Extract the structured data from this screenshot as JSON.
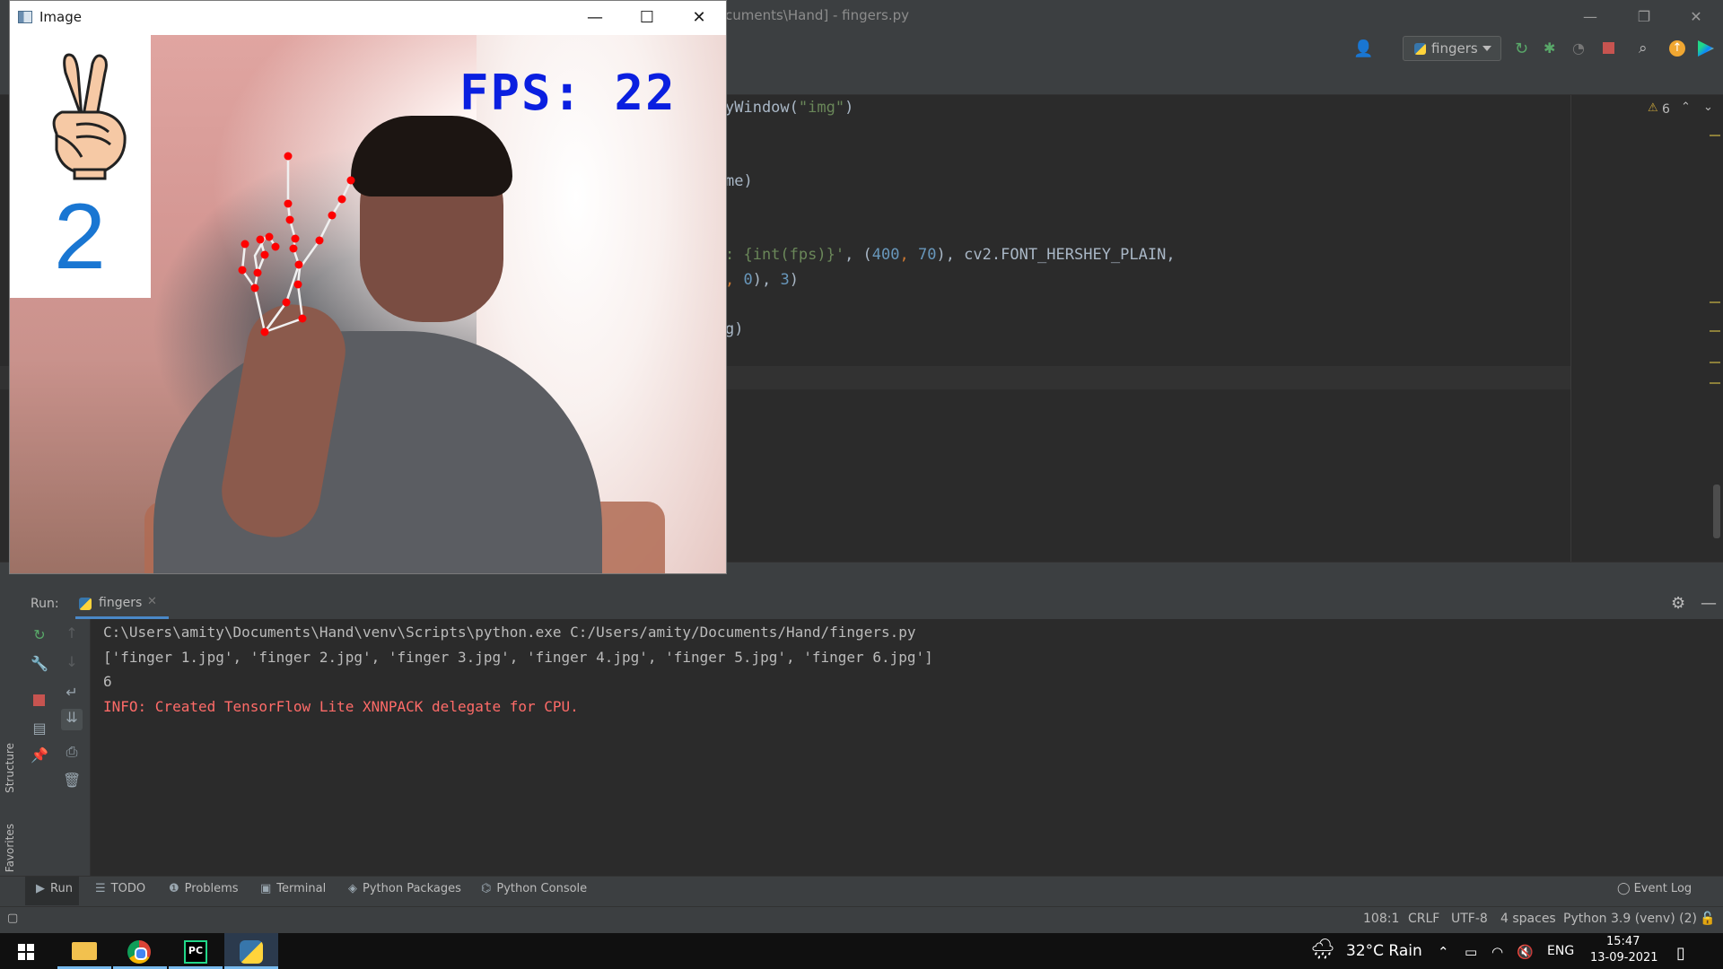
{
  "ide": {
    "title": "cuments\\Hand] - fingers.py",
    "run_config": "fingers",
    "code_lines": [
      {
        "a": "yWindow(",
        "s": "\"img\"",
        "b": ")"
      },
      {
        "a": "me)"
      },
      {
        "a": ": {int(fps)}'",
        "p": ", (",
        "n1": "400",
        "c": ", ",
        "n2": "70",
        "q": "), cv2.FONT_HERSHEY_PLAIN,"
      },
      {
        "a": ", ",
        "n1": "0",
        "q": "), ",
        "n2": "3",
        "r": ")"
      },
      {
        "a": "g)"
      }
    ],
    "warning_count": "6"
  },
  "run_panel": {
    "label": "Run:",
    "tab_label": "fingers",
    "console": [
      "C:\\Users\\amity\\Documents\\Hand\\venv\\Scripts\\python.exe C:/Users/amity/Documents/Hand/fingers.py",
      "['finger 1.jpg', 'finger 2.jpg', 'finger 3.jpg', 'finger 4.jpg', 'finger 5.jpg', 'finger 6.jpg']",
      "6",
      "INFO: Created TensorFlow Lite XNNPACK delegate for CPU."
    ]
  },
  "side_labels": {
    "structure": "Structure",
    "favorites": "Favorites"
  },
  "bottom_tabs": [
    "Run",
    "TODO",
    "Problems",
    "Terminal",
    "Python Packages",
    "Python Console"
  ],
  "event_log": "Event Log",
  "statusbar": {
    "position": "108:1",
    "line_sep": "CRLF",
    "encoding": "UTF-8",
    "indent": "4 spaces",
    "interpreter": "Python 3.9 (venv) (2)"
  },
  "image_window": {
    "title": "Image",
    "finger_count": "2",
    "fps_text": "FPS: 22"
  },
  "taskbar": {
    "weather": "32°C  Rain",
    "lang": "ENG",
    "time": "15:47",
    "date": "13-09-2021"
  },
  "colors": {
    "accent": "#4a88c7",
    "error_text": "#ff6b68",
    "fps_text": "#0a1fe0",
    "finger_count": "#1976d2",
    "landmark": "#ff0000"
  }
}
